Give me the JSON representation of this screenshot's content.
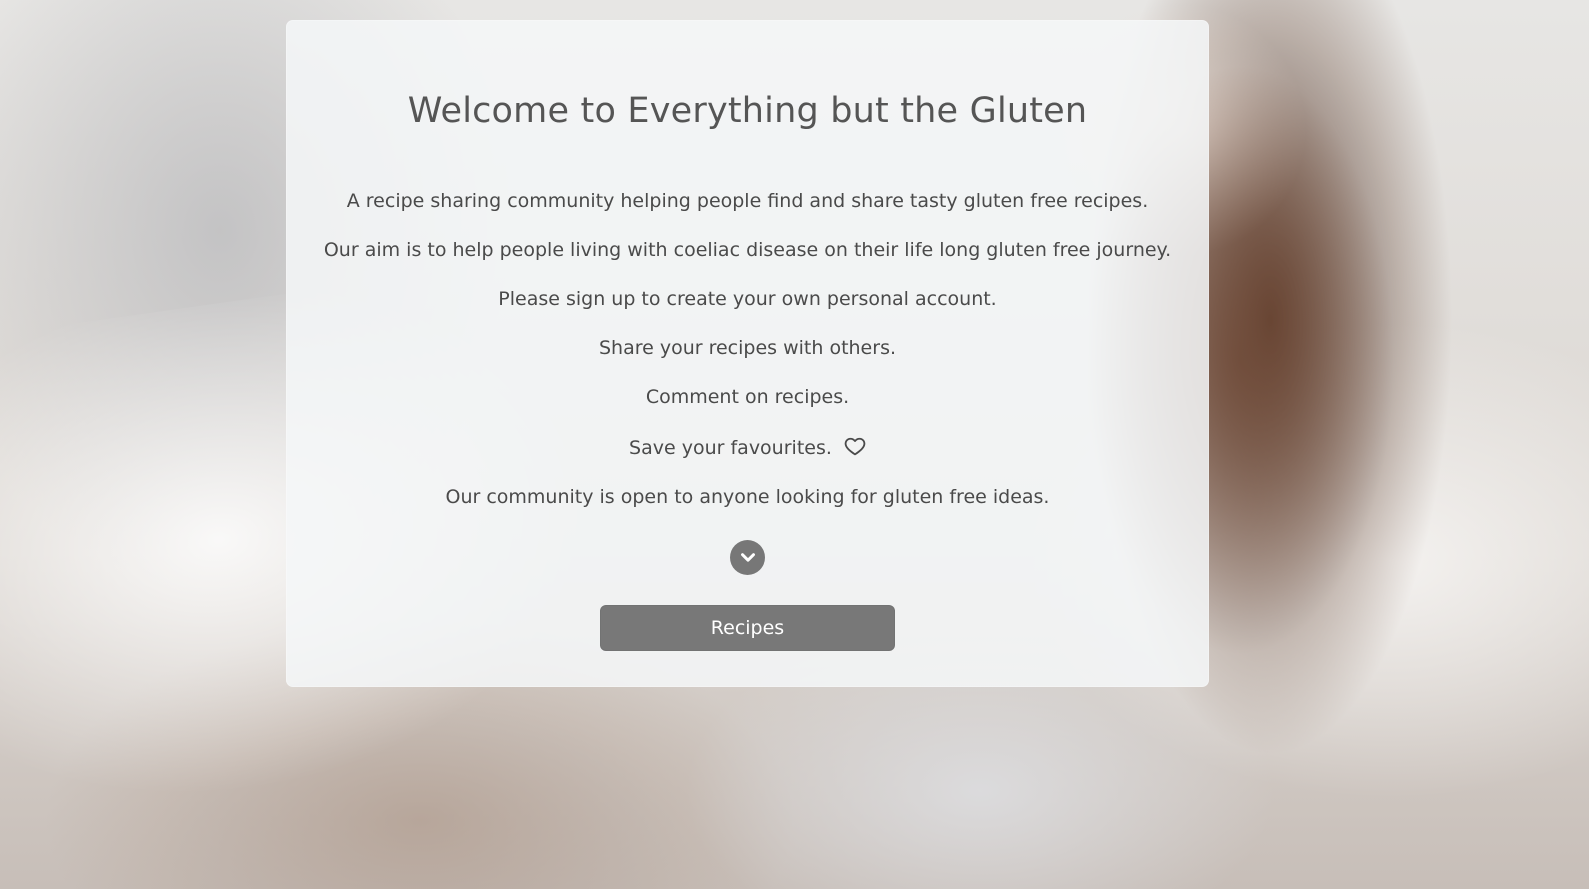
{
  "card": {
    "title": "Welcome to Everything but the Gluten",
    "lines": [
      "A recipe sharing community helping people find and share tasty gluten free recipes.",
      "Our aim is to help people living with coeliac disease on their life long gluten free journey.",
      "Please sign up to create your own personal account.",
      "Share your recipes with others.",
      "Comment on recipes.",
      "Save your favourites.",
      "Our community is open to anyone looking for gluten free ideas."
    ],
    "heart_icon": "heart-outline",
    "scroll_icon": "chevron-down-circle",
    "button_label": "Recipes"
  },
  "colors": {
    "card_bg": "#F5F7F8",
    "button_bg": "#6E6E6E",
    "button_text": "#FFFFFF",
    "text": "#4A4A4A",
    "title": "#555555",
    "chevron_bg": "#777777"
  }
}
